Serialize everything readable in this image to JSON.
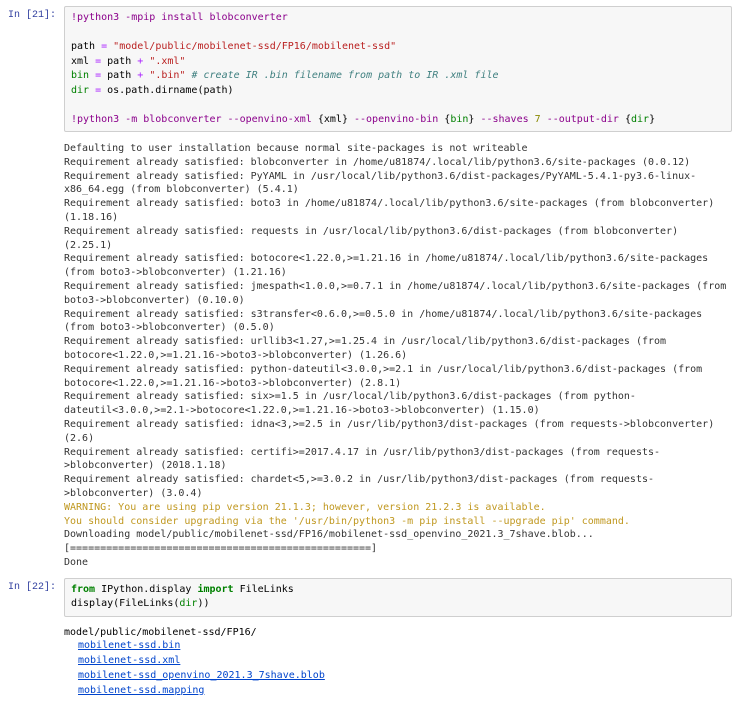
{
  "cells": [
    {
      "prompt": "In [21]:",
      "code_tokens": [
        {
          "t": "!python3 -mpip install blobconverter",
          "c": "sh"
        },
        {
          "t": "\n\n"
        },
        {
          "t": "path "
        },
        {
          "t": "=",
          "c": "op"
        },
        {
          "t": " "
        },
        {
          "t": "\"model/public/mobilenet-ssd/FP16/mobilenet-ssd\"",
          "c": "s"
        },
        {
          "t": "\n"
        },
        {
          "t": "xml "
        },
        {
          "t": "=",
          "c": "op"
        },
        {
          "t": " path "
        },
        {
          "t": "+",
          "c": "op"
        },
        {
          "t": " "
        },
        {
          "t": "\".xml\"",
          "c": "s"
        },
        {
          "t": "\n"
        },
        {
          "t": "bin",
          "c": "bi"
        },
        {
          "t": " "
        },
        {
          "t": "=",
          "c": "op"
        },
        {
          "t": " path "
        },
        {
          "t": "+",
          "c": "op"
        },
        {
          "t": " "
        },
        {
          "t": "\".bin\"",
          "c": "s"
        },
        {
          "t": " "
        },
        {
          "t": "# create IR .bin filename from path to IR .xml file",
          "c": "c"
        },
        {
          "t": "\n"
        },
        {
          "t": "dir",
          "c": "bi"
        },
        {
          "t": " "
        },
        {
          "t": "=",
          "c": "op"
        },
        {
          "t": " os.path.dirname(path)"
        },
        {
          "t": "\n\n"
        },
        {
          "t": "!python3 -m blobconverter --openvino-xml ",
          "c": "sh"
        },
        {
          "t": "{"
        },
        {
          "t": "xml"
        },
        {
          "t": "}"
        },
        {
          "t": " --openvino-bin ",
          "c": "sh"
        },
        {
          "t": "{"
        },
        {
          "t": "bin",
          "c": "bi"
        },
        {
          "t": "}"
        },
        {
          "t": " --shaves ",
          "c": "sh"
        },
        {
          "t": "7",
          "c": "nm"
        },
        {
          "t": " --output-dir ",
          "c": "sh"
        },
        {
          "t": "{"
        },
        {
          "t": "dir",
          "c": "bi"
        },
        {
          "t": "}"
        }
      ],
      "output": [
        {
          "t": "Defaulting to user installation because normal site-packages is not writeable"
        },
        {
          "t": "Requirement already satisfied: blobconverter in /home/u81874/.local/lib/python3.6/site-packages (0.0.12)"
        },
        {
          "t": "Requirement already satisfied: PyYAML in /usr/local/lib/python3.6/dist-packages/PyYAML-5.4.1-py3.6-linux-x86_64.egg (from blobconverter) (5.4.1)"
        },
        {
          "t": "Requirement already satisfied: boto3 in /home/u81874/.local/lib/python3.6/site-packages (from blobconverter) (1.18.16)"
        },
        {
          "t": "Requirement already satisfied: requests in /usr/local/lib/python3.6/dist-packages (from blobconverter) (2.25.1)"
        },
        {
          "t": "Requirement already satisfied: botocore<1.22.0,>=1.21.16 in /home/u81874/.local/lib/python3.6/site-packages (from boto3->blobconverter) (1.21.16)"
        },
        {
          "t": "Requirement already satisfied: jmespath<1.0.0,>=0.7.1 in /home/u81874/.local/lib/python3.6/site-packages (from boto3->blobconverter) (0.10.0)"
        },
        {
          "t": "Requirement already satisfied: s3transfer<0.6.0,>=0.5.0 in /home/u81874/.local/lib/python3.6/site-packages (from boto3->blobconverter) (0.5.0)"
        },
        {
          "t": "Requirement already satisfied: urllib3<1.27,>=1.25.4 in /usr/local/lib/python3.6/dist-packages (from botocore<1.22.0,>=1.21.16->boto3->blobconverter) (1.26.6)"
        },
        {
          "t": "Requirement already satisfied: python-dateutil<3.0.0,>=2.1 in /usr/local/lib/python3.6/dist-packages (from botocore<1.22.0,>=1.21.16->boto3->blobconverter) (2.8.1)"
        },
        {
          "t": "Requirement already satisfied: six>=1.5 in /usr/local/lib/python3.6/dist-packages (from python-dateutil<3.0.0,>=2.1->botocore<1.22.0,>=1.21.16->boto3->blobconverter) (1.15.0)"
        },
        {
          "t": "Requirement already satisfied: idna<3,>=2.5 in /usr/lib/python3/dist-packages (from requests->blobconverter) (2.6)"
        },
        {
          "t": "Requirement already satisfied: certifi>=2017.4.17 in /usr/lib/python3/dist-packages (from requests->blobconverter) (2018.1.18)"
        },
        {
          "t": "Requirement already satisfied: chardet<5,>=3.0.2 in /usr/lib/python3/dist-packages (from requests->blobconverter) (3.0.4)"
        },
        {
          "t": "WARNING: You are using pip version 21.1.3; however, version 21.2.3 is available.",
          "c": "warn"
        },
        {
          "t": "You should consider upgrading via the '/usr/bin/python3 -m pip install --upgrade pip' command.",
          "c": "warn"
        },
        {
          "t": "Downloading model/public/mobilenet-ssd/FP16/mobilenet-ssd_openvino_2021.3_7shave.blob..."
        },
        {
          "t": "[==================================================]"
        },
        {
          "t": "Done"
        }
      ]
    },
    {
      "prompt": "In [22]:",
      "code_tokens": [
        {
          "t": "from",
          "c": "k"
        },
        {
          "t": " IPython.display "
        },
        {
          "t": "import",
          "c": "k"
        },
        {
          "t": " FileLinks\n"
        },
        {
          "t": "display(FileLinks("
        },
        {
          "t": "dir",
          "c": "bi"
        },
        {
          "t": "))"
        }
      ],
      "filelinks_dir": "model/public/mobilenet-ssd/FP16/",
      "filelinks": [
        "mobilenet-ssd.bin",
        "mobilenet-ssd.xml",
        "mobilenet-ssd_openvino_2021.3_7shave.blob",
        "mobilenet-ssd.mapping"
      ]
    }
  ]
}
